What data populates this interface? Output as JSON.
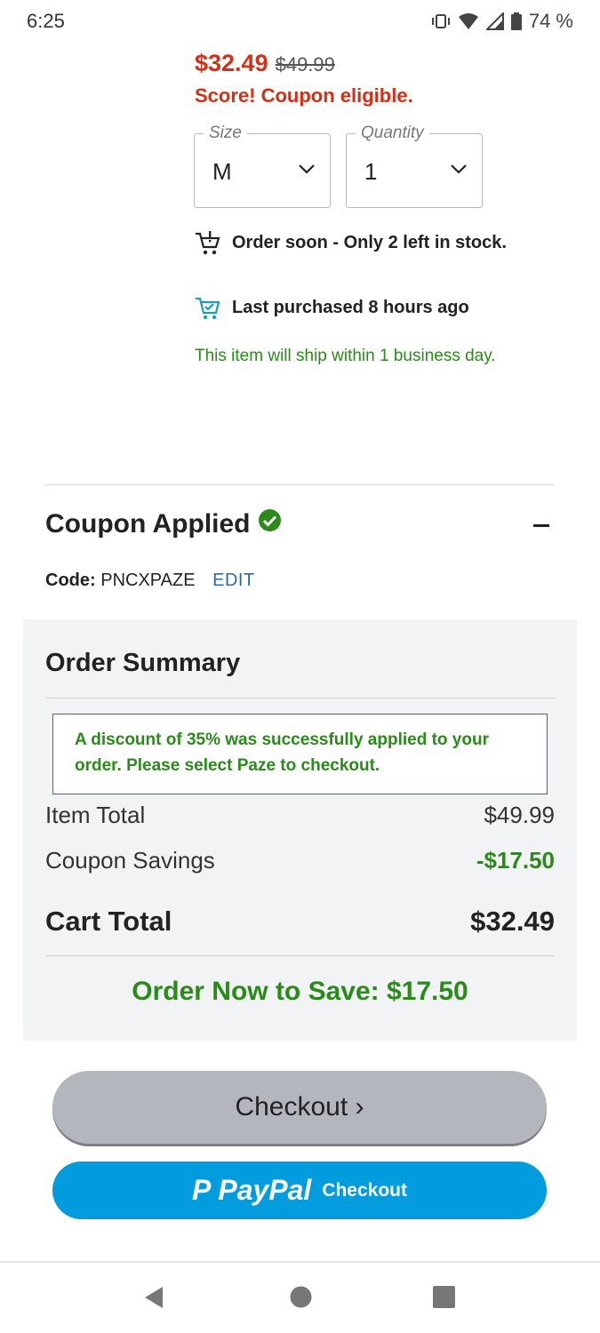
{
  "status_bar": {
    "time": "6:25",
    "battery": "74 %",
    "icons": [
      "vibrate-icon",
      "wifi-icon",
      "signal-icon",
      "battery-icon"
    ]
  },
  "product": {
    "price_now": "$32.49",
    "price_was": "$49.99",
    "coupon_eligible": "Score! Coupon eligible.",
    "size": {
      "label": "Size",
      "value": "M"
    },
    "quantity": {
      "label": "Quantity",
      "value": "1"
    },
    "stock_note": "Order soon - Only 2 left in stock.",
    "last_purchased": "Last purchased 8 hours ago",
    "ship_note": "This item will ship within 1 business day."
  },
  "coupon": {
    "title": "Coupon Applied",
    "code_label": "Code:",
    "code": "PNCXPAZE",
    "edit_label": "EDIT"
  },
  "summary": {
    "title": "Order Summary",
    "notice": "A discount of 35% was successfully applied to your order. Please select Paze to checkout.",
    "item_total_label": "Item Total",
    "item_total": "$49.99",
    "savings_label": "Coupon Savings",
    "savings": "-$17.50",
    "cart_total_label": "Cart Total",
    "cart_total": "$32.49",
    "save_banner": "Order Now to Save: $17.50"
  },
  "buttons": {
    "checkout": "Checkout ›",
    "paypal_mark": "P",
    "paypal_word": "PayPal",
    "paypal_checkout": "Checkout"
  },
  "colors": {
    "price_red": "#d23017",
    "success_green": "#2a8a1a",
    "link_blue": "#2d6aa3",
    "paypal_blue": "#009cde",
    "checkout_gray": "#b3b7bd"
  }
}
